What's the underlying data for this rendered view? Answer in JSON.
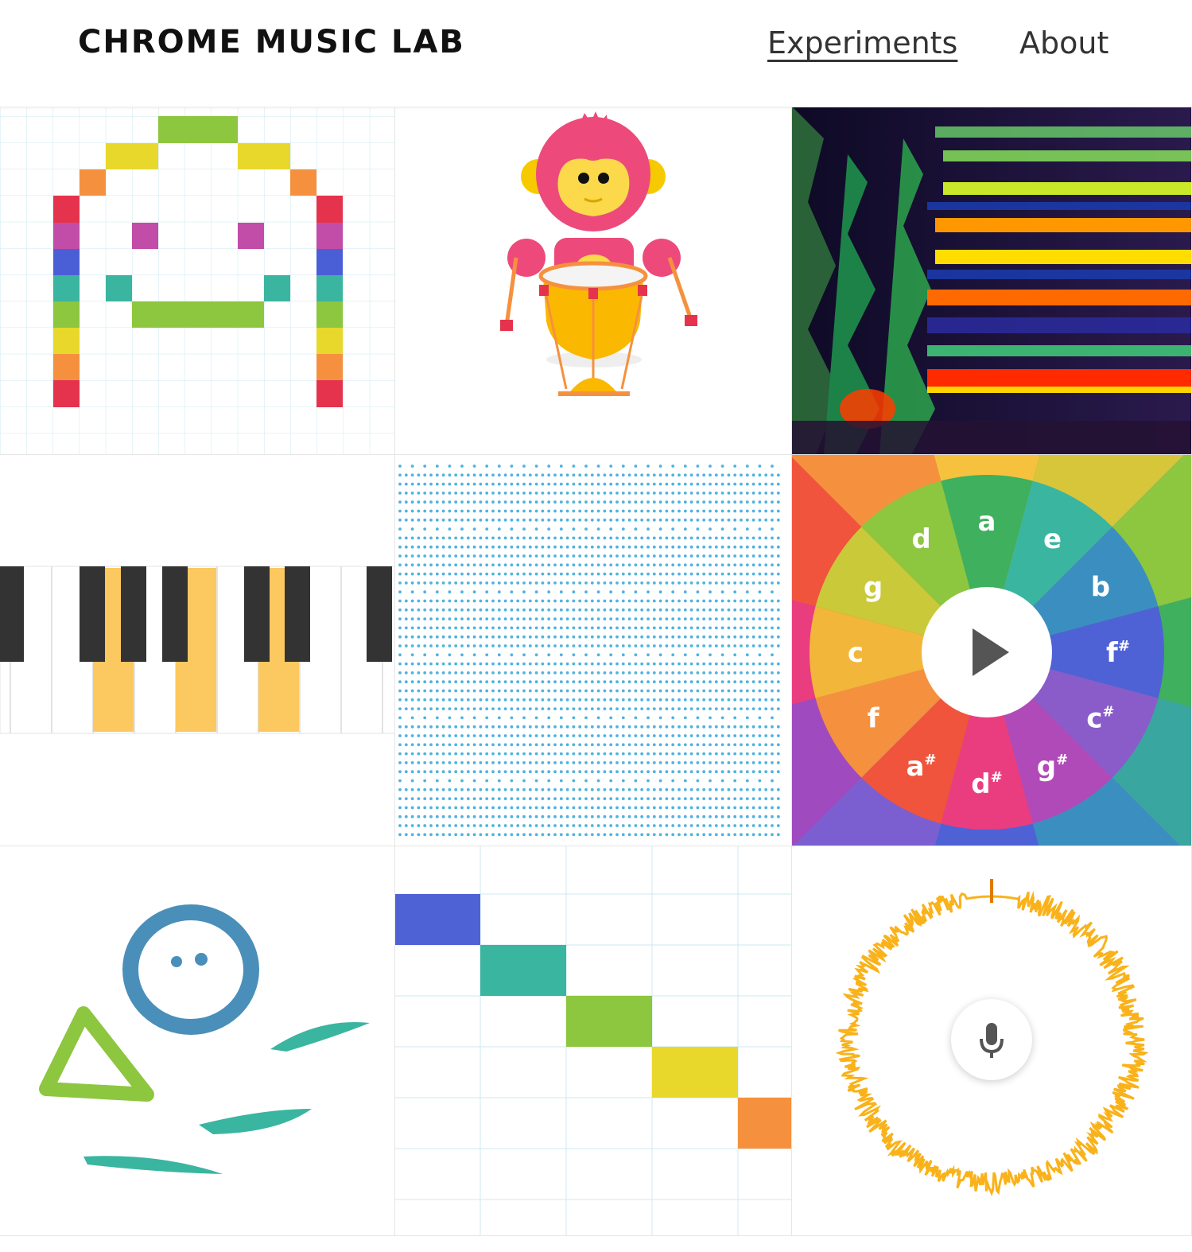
{
  "header": {
    "brand": "CHROME MUSIC LAB",
    "nav": {
      "experiments": "Experiments",
      "about": "About"
    }
  },
  "chords_wheel": {
    "notes": [
      "a",
      "e",
      "b",
      "f#",
      "c#",
      "g#",
      "d#",
      "a#",
      "f",
      "c",
      "g",
      "d"
    ]
  },
  "icons": {
    "play": "play-icon",
    "microphone": "microphone-icon"
  },
  "colors": {
    "accent_blue": "#4d9fd6",
    "voice_spinner": "#f9b21a"
  }
}
